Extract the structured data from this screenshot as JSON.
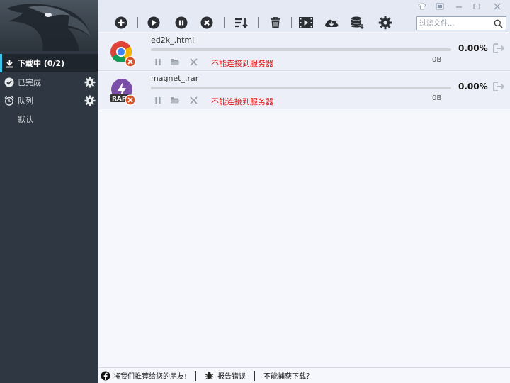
{
  "sidebar": {
    "items": [
      {
        "label": "下载中 (0/2)",
        "icon": "download-icon"
      },
      {
        "label": "已完成",
        "icon": "check-circle-icon"
      },
      {
        "label": "队列",
        "icon": "alarm-clock-icon"
      },
      {
        "label": "默认"
      }
    ]
  },
  "toolbar": {
    "buttons": [
      "add-icon",
      "play-icon",
      "pause-icon",
      "cancel-icon",
      "sort-icon",
      "trash-icon",
      "video-icon",
      "cloud-download-icon",
      "database-icon",
      "gear-icon"
    ],
    "search_placeholder": "过滤文件..."
  },
  "downloads": [
    {
      "name": "ed2k_.html",
      "percent": "0.00%",
      "progress": 0,
      "status": "不能连接到服务器",
      "size": "0B",
      "icon": "chrome-file-icon"
    },
    {
      "name": "magnet_.rar",
      "percent": "0.00%",
      "progress": 0,
      "status": "不能连接到服务器",
      "size": "0B",
      "icon": "rar-file-icon"
    }
  ],
  "statusbar": {
    "recommend": "将我们推荐给您的朋友!",
    "report": "报告错误",
    "cannot_capture": "不能捕获下载？"
  },
  "colors": {
    "sidebar_bg": "#2f3842",
    "accent": "#3dc2e8",
    "error_text": "#e01010"
  }
}
